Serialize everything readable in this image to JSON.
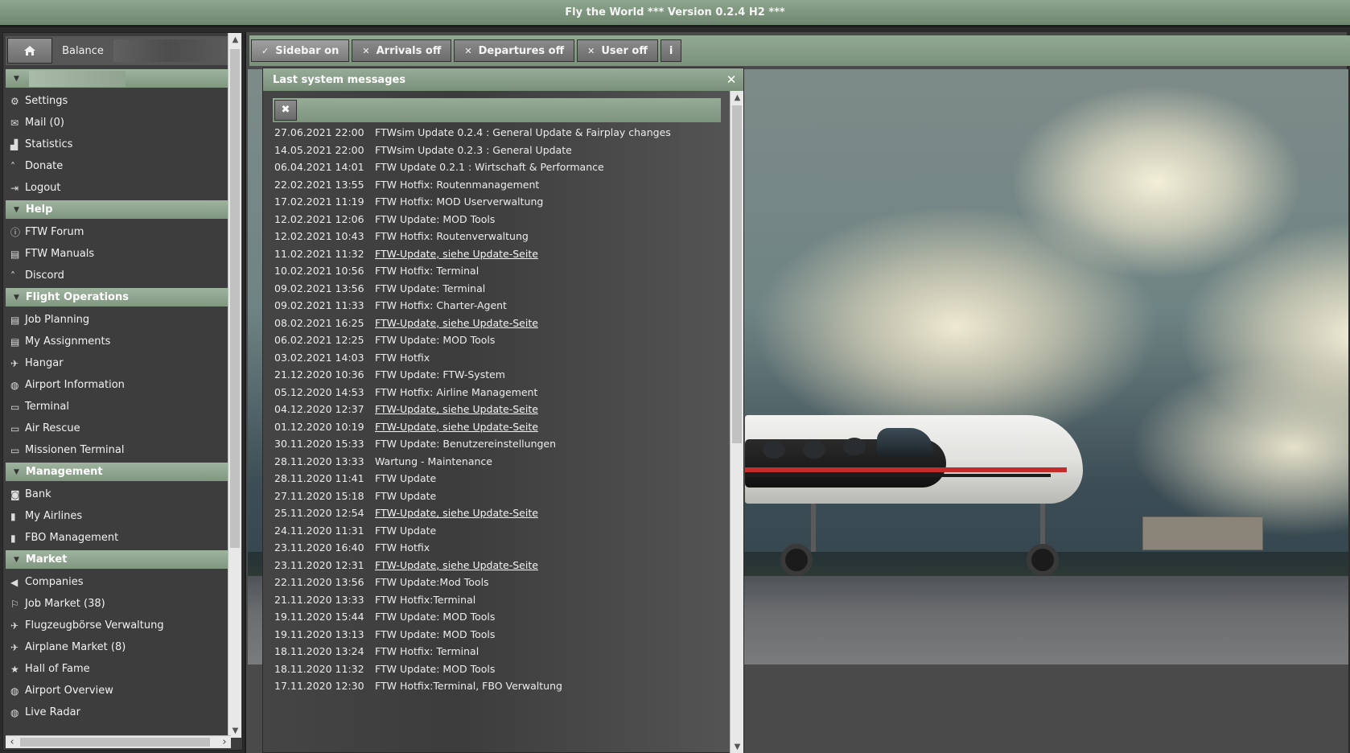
{
  "app": {
    "title": "Fly the World *** Version 0.2.4 H2 ***"
  },
  "sidebar": {
    "balance_label": "Balance",
    "sections": [
      {
        "title": "",
        "items": [
          {
            "label": "Settings",
            "icon": "gear-icon",
            "glyph": "⚙"
          },
          {
            "label": "Mail (0)",
            "icon": "mail-icon",
            "glyph": "✉"
          },
          {
            "label": "Statistics",
            "icon": "statistics-icon",
            "glyph": "▟"
          },
          {
            "label": "Donate",
            "icon": "donate-icon",
            "glyph": "˄"
          },
          {
            "label": "Logout",
            "icon": "logout-icon",
            "glyph": "⇥"
          }
        ]
      },
      {
        "title": "Help",
        "items": [
          {
            "label": "FTW Forum",
            "icon": "info-icon",
            "glyph": "ⓘ"
          },
          {
            "label": "FTW Manuals",
            "icon": "book-icon",
            "glyph": "▤"
          },
          {
            "label": "Discord",
            "icon": "discord-icon",
            "glyph": "˄"
          }
        ]
      },
      {
        "title": "Flight Operations",
        "items": [
          {
            "label": "Job Planning",
            "icon": "clipboard-icon",
            "glyph": "▤"
          },
          {
            "label": "My Assignments",
            "icon": "list-icon",
            "glyph": "▤"
          },
          {
            "label": "Hangar",
            "icon": "plane-icon",
            "glyph": "✈"
          },
          {
            "label": "Airport Information",
            "icon": "globe-icon",
            "glyph": "◍"
          },
          {
            "label": "Terminal",
            "icon": "laptop-icon",
            "glyph": "▭"
          },
          {
            "label": "Air Rescue",
            "icon": "laptop-icon",
            "glyph": "▭"
          },
          {
            "label": "Missionen Terminal",
            "icon": "laptop-icon",
            "glyph": "▭"
          }
        ]
      },
      {
        "title": "Management",
        "items": [
          {
            "label": "Bank",
            "icon": "money-icon",
            "glyph": "◙"
          },
          {
            "label": "My Airlines",
            "icon": "building-icon",
            "glyph": "▮"
          },
          {
            "label": "FBO Management",
            "icon": "building-icon",
            "glyph": "▮"
          }
        ]
      },
      {
        "title": "Market",
        "items": [
          {
            "label": "Companies",
            "icon": "megaphone-icon",
            "glyph": "◀"
          },
          {
            "label": "Job Market (38)",
            "icon": "flag-icon",
            "glyph": "⚐"
          },
          {
            "label": "Flugzeugbörse Verwaltung",
            "icon": "plane-icon",
            "glyph": "✈"
          },
          {
            "label": "Airplane Market (8)",
            "icon": "plane-icon",
            "glyph": "✈"
          },
          {
            "label": "Hall of Fame",
            "icon": "star-icon",
            "glyph": "★"
          },
          {
            "label": "Airport Overview",
            "icon": "globe-icon",
            "glyph": "◍"
          },
          {
            "label": "Live Radar",
            "icon": "globe-icon",
            "glyph": "◍"
          }
        ]
      }
    ]
  },
  "toolbar": {
    "buttons": [
      {
        "label": "Sidebar on",
        "mark": "✓",
        "active": true
      },
      {
        "label": "Arrivals off",
        "mark": "✕",
        "active": false
      },
      {
        "label": "Departures off",
        "mark": "✕",
        "active": false
      },
      {
        "label": "User off",
        "mark": "✕",
        "active": false
      }
    ],
    "info_label": "i"
  },
  "messages_panel": {
    "title": "Last system messages",
    "clear_label": "✖",
    "messages": [
      {
        "date": "27.06.2021 22:00",
        "text": "FTWsim Update 0.2.4 : General Update & Fairplay changes",
        "link": false
      },
      {
        "date": "14.05.2021 22:00",
        "text": "FTWsim Update 0.2.3 : General Update",
        "link": false
      },
      {
        "date": "06.04.2021 14:01",
        "text": "FTW Update 0.2.1 : Wirtschaft & Performance",
        "link": false
      },
      {
        "date": "22.02.2021 13:55",
        "text": "FTW Hotfix: Routenmanagement",
        "link": false
      },
      {
        "date": "17.02.2021 11:19",
        "text": "FTW Hotfix: MOD Userverwaltung",
        "link": false
      },
      {
        "date": "12.02.2021 12:06",
        "text": "FTW Update: MOD Tools",
        "link": false
      },
      {
        "date": "12.02.2021 10:43",
        "text": "FTW Hotfix: Routenverwaltung",
        "link": false
      },
      {
        "date": "11.02.2021 11:32",
        "text": "FTW-Update, siehe Update-Seite",
        "link": true
      },
      {
        "date": "10.02.2021 10:56",
        "text": "FTW Hotfix: Terminal",
        "link": false
      },
      {
        "date": "09.02.2021 13:56",
        "text": "FTW Update: Terminal",
        "link": false
      },
      {
        "date": "09.02.2021 11:33",
        "text": "FTW Hotfix: Charter-Agent",
        "link": false
      },
      {
        "date": "08.02.2021 16:25",
        "text": "FTW-Update, siehe Update-Seite",
        "link": true
      },
      {
        "date": "06.02.2021 12:25",
        "text": "FTW Update: MOD Tools",
        "link": false
      },
      {
        "date": "03.02.2021 14:03",
        "text": "FTW Hotfix",
        "link": false
      },
      {
        "date": "21.12.2020 10:36",
        "text": "FTW Update: FTW-System",
        "link": false
      },
      {
        "date": "05.12.2020 14:53",
        "text": "FTW Hotfix: Airline Management",
        "link": false
      },
      {
        "date": "04.12.2020 12:37",
        "text": "FTW-Update, siehe Update-Seite",
        "link": true
      },
      {
        "date": "01.12.2020 10:19",
        "text": "FTW-Update, siehe Update-Seite",
        "link": true
      },
      {
        "date": "30.11.2020 15:33",
        "text": "FTW Update: Benutzereinstellungen",
        "link": false
      },
      {
        "date": "28.11.2020 13:33",
        "text": "Wartung - Maintenance",
        "link": false
      },
      {
        "date": "28.11.2020 11:41",
        "text": "FTW Update",
        "link": false
      },
      {
        "date": "27.11.2020 15:18",
        "text": "FTW Update",
        "link": false
      },
      {
        "date": "25.11.2020 12:54",
        "text": "FTW-Update, siehe Update-Seite",
        "link": true
      },
      {
        "date": "24.11.2020 11:31",
        "text": "FTW Update",
        "link": false
      },
      {
        "date": "23.11.2020 16:40",
        "text": "FTW Hotfix",
        "link": false
      },
      {
        "date": "23.11.2020 12:31",
        "text": "FTW-Update, siehe Update-Seite",
        "link": true
      },
      {
        "date": "22.11.2020 13:56",
        "text": "FTW Update:Mod Tools",
        "link": false
      },
      {
        "date": "21.11.2020 13:33",
        "text": "FTW Hotfix:Terminal",
        "link": false
      },
      {
        "date": "19.11.2020 15:44",
        "text": "FTW Update: MOD Tools",
        "link": false
      },
      {
        "date": "19.11.2020 13:13",
        "text": "FTW Update: MOD Tools",
        "link": false
      },
      {
        "date": "18.11.2020 13:24",
        "text": "FTW Hotfix: Terminal",
        "link": false
      },
      {
        "date": "18.11.2020 11:32",
        "text": "FTW Update: MOD Tools",
        "link": false
      },
      {
        "date": "17.11.2020 12:30",
        "text": "FTW Hotfix:Terminal, FBO Verwaltung",
        "link": false
      }
    ]
  }
}
